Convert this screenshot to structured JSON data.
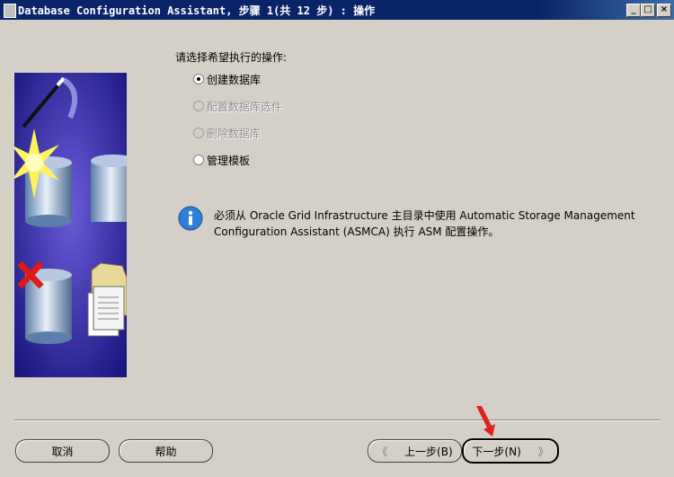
{
  "window": {
    "title": "Database Configuration Assistant, 步骤 1(共 12 步) : 操作",
    "minimize": "_",
    "maximize": "□",
    "close": "×"
  },
  "main": {
    "prompt": "请选择希望执行的操作:",
    "options": [
      {
        "label": "创建数据库",
        "selected": true,
        "enabled": true
      },
      {
        "label": "配置数据库选件",
        "selected": false,
        "enabled": false
      },
      {
        "label": "删除数据库",
        "selected": false,
        "enabled": false
      },
      {
        "label": "管理模板",
        "selected": false,
        "enabled": true
      }
    ],
    "info_line1": "必须从 Oracle Grid Infrastructure 主目录中使用 Automatic Storage Management",
    "info_line2": "Configuration Assistant (ASMCA) 执行 ASM 配置操作。"
  },
  "footer": {
    "cancel_label": "取消",
    "help_label": "帮助",
    "back_label": "上一步(B)",
    "next_label": "下一步(N)",
    "back_arrow": "《",
    "next_arrow": "》"
  },
  "colors": {
    "titlebar": "#0a246a",
    "window_bg": "#d4d0c8",
    "image_bg": "#2b2a9e",
    "pointer": "#e0201c"
  }
}
